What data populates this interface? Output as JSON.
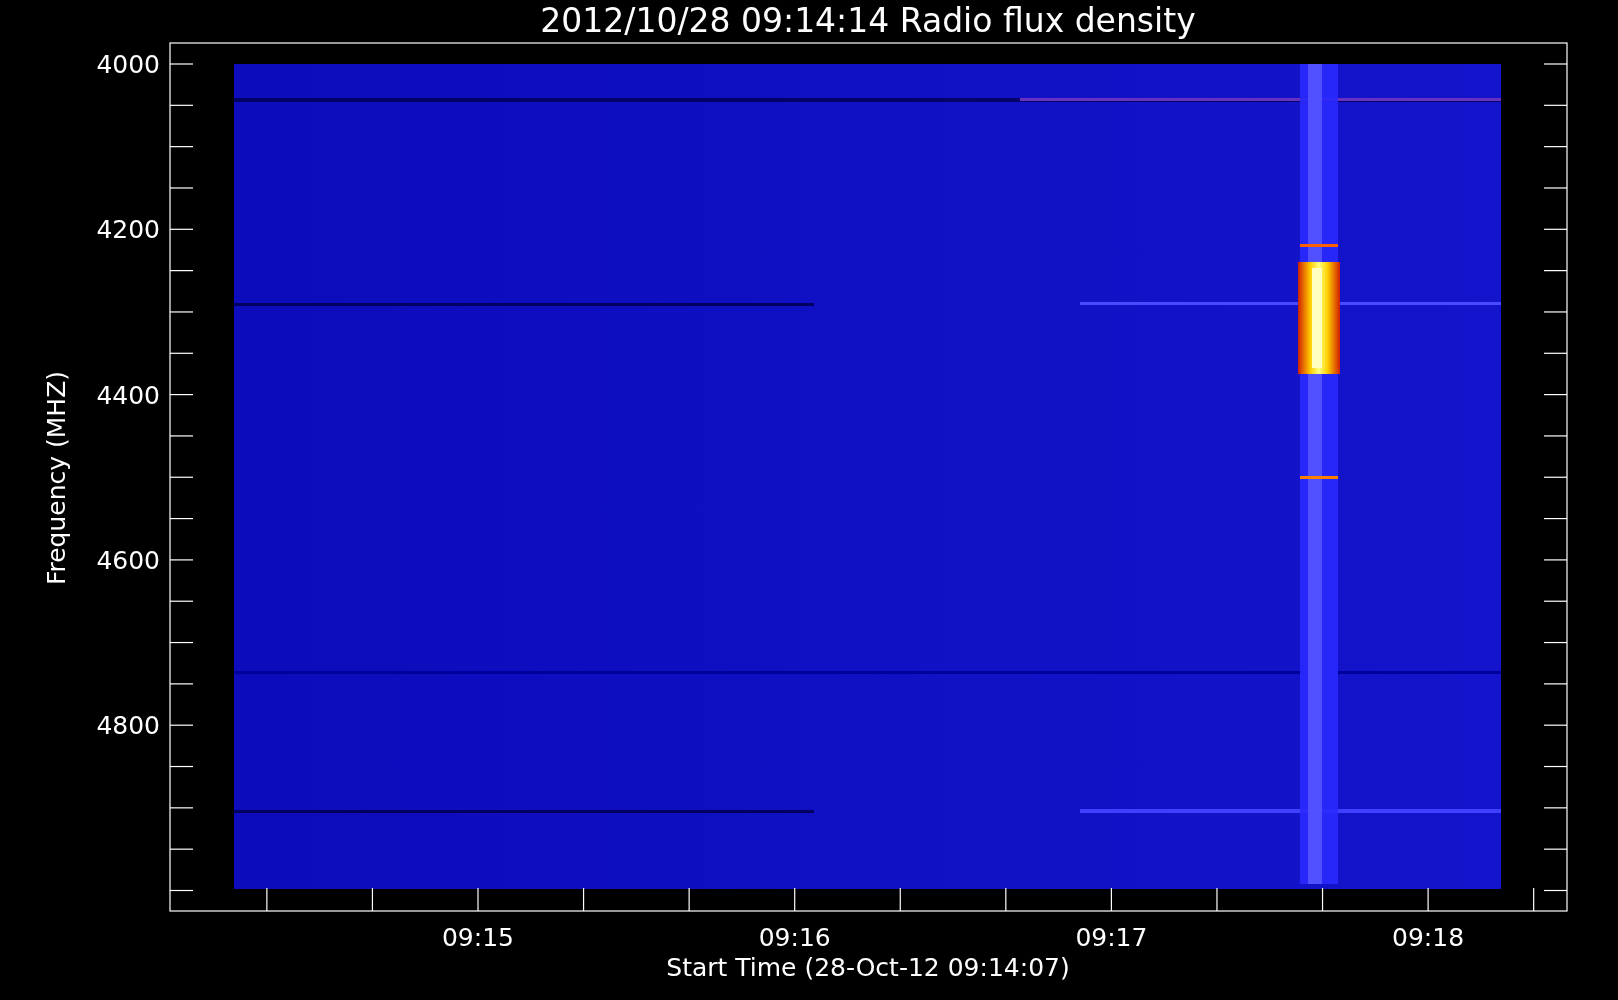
{
  "title": "2012/10/28 09:14:14 Radio flux density",
  "plot": {
    "ylabel": "Frequency (MHZ)",
    "xlabel": "Start Time (28-Oct-12 09:14:07)",
    "yticks": [
      "4000",
      "4200",
      "4400",
      "4600",
      "4800"
    ],
    "xticks": [
      "09:15",
      "09:16",
      "09:17",
      "09:18"
    ]
  }
}
